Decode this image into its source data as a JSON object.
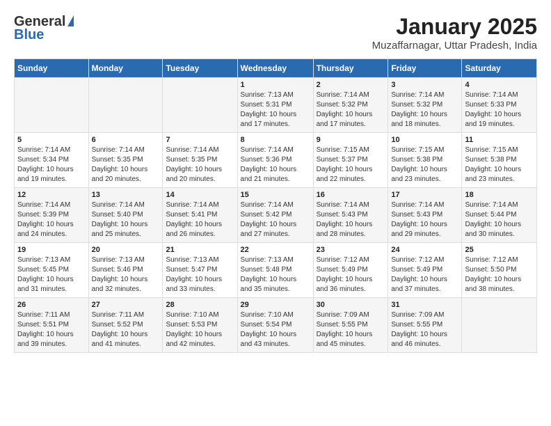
{
  "header": {
    "logo_general": "General",
    "logo_blue": "Blue",
    "title": "January 2025",
    "subtitle": "Muzaffarnagar, Uttar Pradesh, India"
  },
  "days_of_week": [
    "Sunday",
    "Monday",
    "Tuesday",
    "Wednesday",
    "Thursday",
    "Friday",
    "Saturday"
  ],
  "weeks": [
    [
      {
        "day": "",
        "content": ""
      },
      {
        "day": "",
        "content": ""
      },
      {
        "day": "",
        "content": ""
      },
      {
        "day": "1",
        "content": "Sunrise: 7:13 AM\nSunset: 5:31 PM\nDaylight: 10 hours\nand 17 minutes."
      },
      {
        "day": "2",
        "content": "Sunrise: 7:14 AM\nSunset: 5:32 PM\nDaylight: 10 hours\nand 17 minutes."
      },
      {
        "day": "3",
        "content": "Sunrise: 7:14 AM\nSunset: 5:32 PM\nDaylight: 10 hours\nand 18 minutes."
      },
      {
        "day": "4",
        "content": "Sunrise: 7:14 AM\nSunset: 5:33 PM\nDaylight: 10 hours\nand 19 minutes."
      }
    ],
    [
      {
        "day": "5",
        "content": "Sunrise: 7:14 AM\nSunset: 5:34 PM\nDaylight: 10 hours\nand 19 minutes."
      },
      {
        "day": "6",
        "content": "Sunrise: 7:14 AM\nSunset: 5:35 PM\nDaylight: 10 hours\nand 20 minutes."
      },
      {
        "day": "7",
        "content": "Sunrise: 7:14 AM\nSunset: 5:35 PM\nDaylight: 10 hours\nand 20 minutes."
      },
      {
        "day": "8",
        "content": "Sunrise: 7:14 AM\nSunset: 5:36 PM\nDaylight: 10 hours\nand 21 minutes."
      },
      {
        "day": "9",
        "content": "Sunrise: 7:15 AM\nSunset: 5:37 PM\nDaylight: 10 hours\nand 22 minutes."
      },
      {
        "day": "10",
        "content": "Sunrise: 7:15 AM\nSunset: 5:38 PM\nDaylight: 10 hours\nand 23 minutes."
      },
      {
        "day": "11",
        "content": "Sunrise: 7:15 AM\nSunset: 5:38 PM\nDaylight: 10 hours\nand 23 minutes."
      }
    ],
    [
      {
        "day": "12",
        "content": "Sunrise: 7:14 AM\nSunset: 5:39 PM\nDaylight: 10 hours\nand 24 minutes."
      },
      {
        "day": "13",
        "content": "Sunrise: 7:14 AM\nSunset: 5:40 PM\nDaylight: 10 hours\nand 25 minutes."
      },
      {
        "day": "14",
        "content": "Sunrise: 7:14 AM\nSunset: 5:41 PM\nDaylight: 10 hours\nand 26 minutes."
      },
      {
        "day": "15",
        "content": "Sunrise: 7:14 AM\nSunset: 5:42 PM\nDaylight: 10 hours\nand 27 minutes."
      },
      {
        "day": "16",
        "content": "Sunrise: 7:14 AM\nSunset: 5:43 PM\nDaylight: 10 hours\nand 28 minutes."
      },
      {
        "day": "17",
        "content": "Sunrise: 7:14 AM\nSunset: 5:43 PM\nDaylight: 10 hours\nand 29 minutes."
      },
      {
        "day": "18",
        "content": "Sunrise: 7:14 AM\nSunset: 5:44 PM\nDaylight: 10 hours\nand 30 minutes."
      }
    ],
    [
      {
        "day": "19",
        "content": "Sunrise: 7:13 AM\nSunset: 5:45 PM\nDaylight: 10 hours\nand 31 minutes."
      },
      {
        "day": "20",
        "content": "Sunrise: 7:13 AM\nSunset: 5:46 PM\nDaylight: 10 hours\nand 32 minutes."
      },
      {
        "day": "21",
        "content": "Sunrise: 7:13 AM\nSunset: 5:47 PM\nDaylight: 10 hours\nand 33 minutes."
      },
      {
        "day": "22",
        "content": "Sunrise: 7:13 AM\nSunset: 5:48 PM\nDaylight: 10 hours\nand 35 minutes."
      },
      {
        "day": "23",
        "content": "Sunrise: 7:12 AM\nSunset: 5:49 PM\nDaylight: 10 hours\nand 36 minutes."
      },
      {
        "day": "24",
        "content": "Sunrise: 7:12 AM\nSunset: 5:49 PM\nDaylight: 10 hours\nand 37 minutes."
      },
      {
        "day": "25",
        "content": "Sunrise: 7:12 AM\nSunset: 5:50 PM\nDaylight: 10 hours\nand 38 minutes."
      }
    ],
    [
      {
        "day": "26",
        "content": "Sunrise: 7:11 AM\nSunset: 5:51 PM\nDaylight: 10 hours\nand 39 minutes."
      },
      {
        "day": "27",
        "content": "Sunrise: 7:11 AM\nSunset: 5:52 PM\nDaylight: 10 hours\nand 41 minutes."
      },
      {
        "day": "28",
        "content": "Sunrise: 7:10 AM\nSunset: 5:53 PM\nDaylight: 10 hours\nand 42 minutes."
      },
      {
        "day": "29",
        "content": "Sunrise: 7:10 AM\nSunset: 5:54 PM\nDaylight: 10 hours\nand 43 minutes."
      },
      {
        "day": "30",
        "content": "Sunrise: 7:09 AM\nSunset: 5:55 PM\nDaylight: 10 hours\nand 45 minutes."
      },
      {
        "day": "31",
        "content": "Sunrise: 7:09 AM\nSunset: 5:55 PM\nDaylight: 10 hours\nand 46 minutes."
      },
      {
        "day": "",
        "content": ""
      }
    ]
  ]
}
